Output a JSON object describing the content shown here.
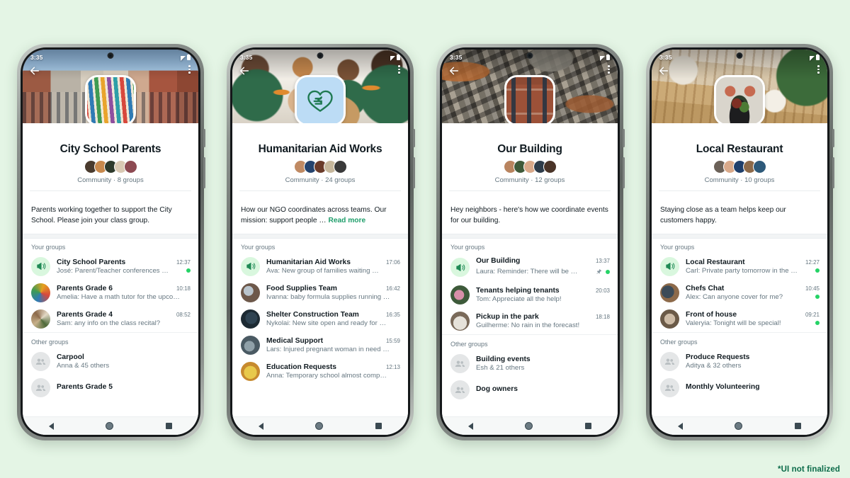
{
  "background_color": "#e4f5e5",
  "accent_color": "#1f9e6b",
  "unread_dot_color": "#25d366",
  "footnote": "*UI not finalized",
  "status_bar": {
    "time": "3:35",
    "signal_icon": "signal-icon",
    "battery_icon": "battery-icon"
  },
  "nav_bar": {
    "back": "nav-back-icon",
    "home": "nav-home-icon",
    "recents": "nav-recents-icon"
  },
  "common": {
    "back_icon": "back-arrow-icon",
    "menu_icon": "overflow-menu-icon",
    "your_groups_label": "Your groups",
    "other_groups_label": "Other groups",
    "announcement_icon": "megaphone-icon",
    "group_placeholder_icon": "group-avatar-icon",
    "pin_icon": "pin-icon"
  },
  "phones": [
    {
      "id": "city-school-parents",
      "cover_image": "school-building-photo",
      "community_icon": "books-photo",
      "title": "City School Parents",
      "meta": "Community · 8 groups",
      "description": "Parents working together to support the City School. Please join your class group.",
      "read_more": null,
      "your_groups": [
        {
          "name": "City School Parents",
          "time": "12:37",
          "message": "José: Parent/Teacher conferences …",
          "announcement": true,
          "unread": true,
          "pinned": false
        },
        {
          "name": "Parents Grade 6",
          "time": "10:18",
          "message": "Amelia: Have a math tutor for the upco…",
          "announcement": false,
          "unread": false,
          "pinned": false
        },
        {
          "name": "Parents Grade 4",
          "time": "08:52",
          "message": "Sam: any info on the class recital?",
          "announcement": false,
          "unread": false,
          "pinned": false
        }
      ],
      "other_groups": [
        {
          "name": "Carpool",
          "sub": "Anna & 45 others"
        },
        {
          "name": "Parents Grade 5",
          "sub": ""
        }
      ]
    },
    {
      "id": "humanitarian-aid-works",
      "cover_image": "volunteers-packing-photo",
      "community_icon": "heart-hand-icon",
      "title": "Humanitarian Aid Works",
      "meta": "Community · 24 groups",
      "description": "How our NGO coordinates across teams. Our mission: support people …",
      "read_more": "Read more",
      "your_groups": [
        {
          "name": "Humanitarian Aid Works",
          "time": "17:06",
          "message": "Ava: New group of families waiting …",
          "announcement": true,
          "unread": false,
          "pinned": false
        },
        {
          "name": "Food Supplies Team",
          "time": "16:42",
          "message": "Ivanna: baby formula supplies running …",
          "announcement": false,
          "unread": false,
          "pinned": false
        },
        {
          "name": "Shelter Construction Team",
          "time": "16:35",
          "message": "Nykolai: New site open and ready for …",
          "announcement": false,
          "unread": false,
          "pinned": false
        },
        {
          "name": "Medical Support",
          "time": "15:59",
          "message": "Lars: Injured pregnant woman in need …",
          "announcement": false,
          "unread": false,
          "pinned": false
        },
        {
          "name": "Education Requests",
          "time": "12:13",
          "message": "Anna: Temporary school almost comp…",
          "announcement": false,
          "unread": false,
          "pinned": false
        }
      ],
      "other_groups": []
    },
    {
      "id": "our-building",
      "cover_image": "aerial-city-photo",
      "community_icon": "brick-building-photo",
      "title": "Our Building",
      "meta": "Community · 12 groups",
      "description": "Hey neighbors - here's how we coordinate events for our building.",
      "read_more": null,
      "your_groups": [
        {
          "name": "Our Building",
          "time": "13:37",
          "message": "Laura: Reminder:  There will be …",
          "announcement": true,
          "unread": true,
          "pinned": true
        },
        {
          "name": "Tenants helping tenants",
          "time": "20:03",
          "message": "Tom: Appreciate all the help!",
          "announcement": false,
          "unread": false,
          "pinned": false
        },
        {
          "name": "Pickup in the park",
          "time": "18:18",
          "message": "Guilherme: No rain in the forecast!",
          "announcement": false,
          "unread": false,
          "pinned": false
        }
      ],
      "other_groups": [
        {
          "name": "Building events",
          "sub": "Esh & 21 others"
        },
        {
          "name": "Dog owners",
          "sub": ""
        }
      ]
    },
    {
      "id": "local-restaurant",
      "cover_image": "restaurant-patio-photo",
      "community_icon": "plated-dish-photo",
      "title": "Local Restaurant",
      "meta": "Community · 10 groups",
      "description": "Staying close as a team helps keep our customers happy.",
      "read_more": null,
      "your_groups": [
        {
          "name": "Local Restaurant",
          "time": "12:27",
          "message": "Carl: Private party tomorrow in the …",
          "announcement": true,
          "unread": true,
          "pinned": false
        },
        {
          "name": "Chefs Chat",
          "time": "10:45",
          "message": "Alex: Can anyone cover for me?",
          "announcement": false,
          "unread": true,
          "pinned": false
        },
        {
          "name": "Front of house",
          "time": "09:21",
          "message": "Valeryia: Tonight will be special!",
          "announcement": false,
          "unread": true,
          "pinned": false
        }
      ],
      "other_groups": [
        {
          "name": "Produce Requests",
          "sub": "Aditya & 32 others"
        },
        {
          "name": "Monthly Volunteering",
          "sub": ""
        }
      ]
    }
  ]
}
